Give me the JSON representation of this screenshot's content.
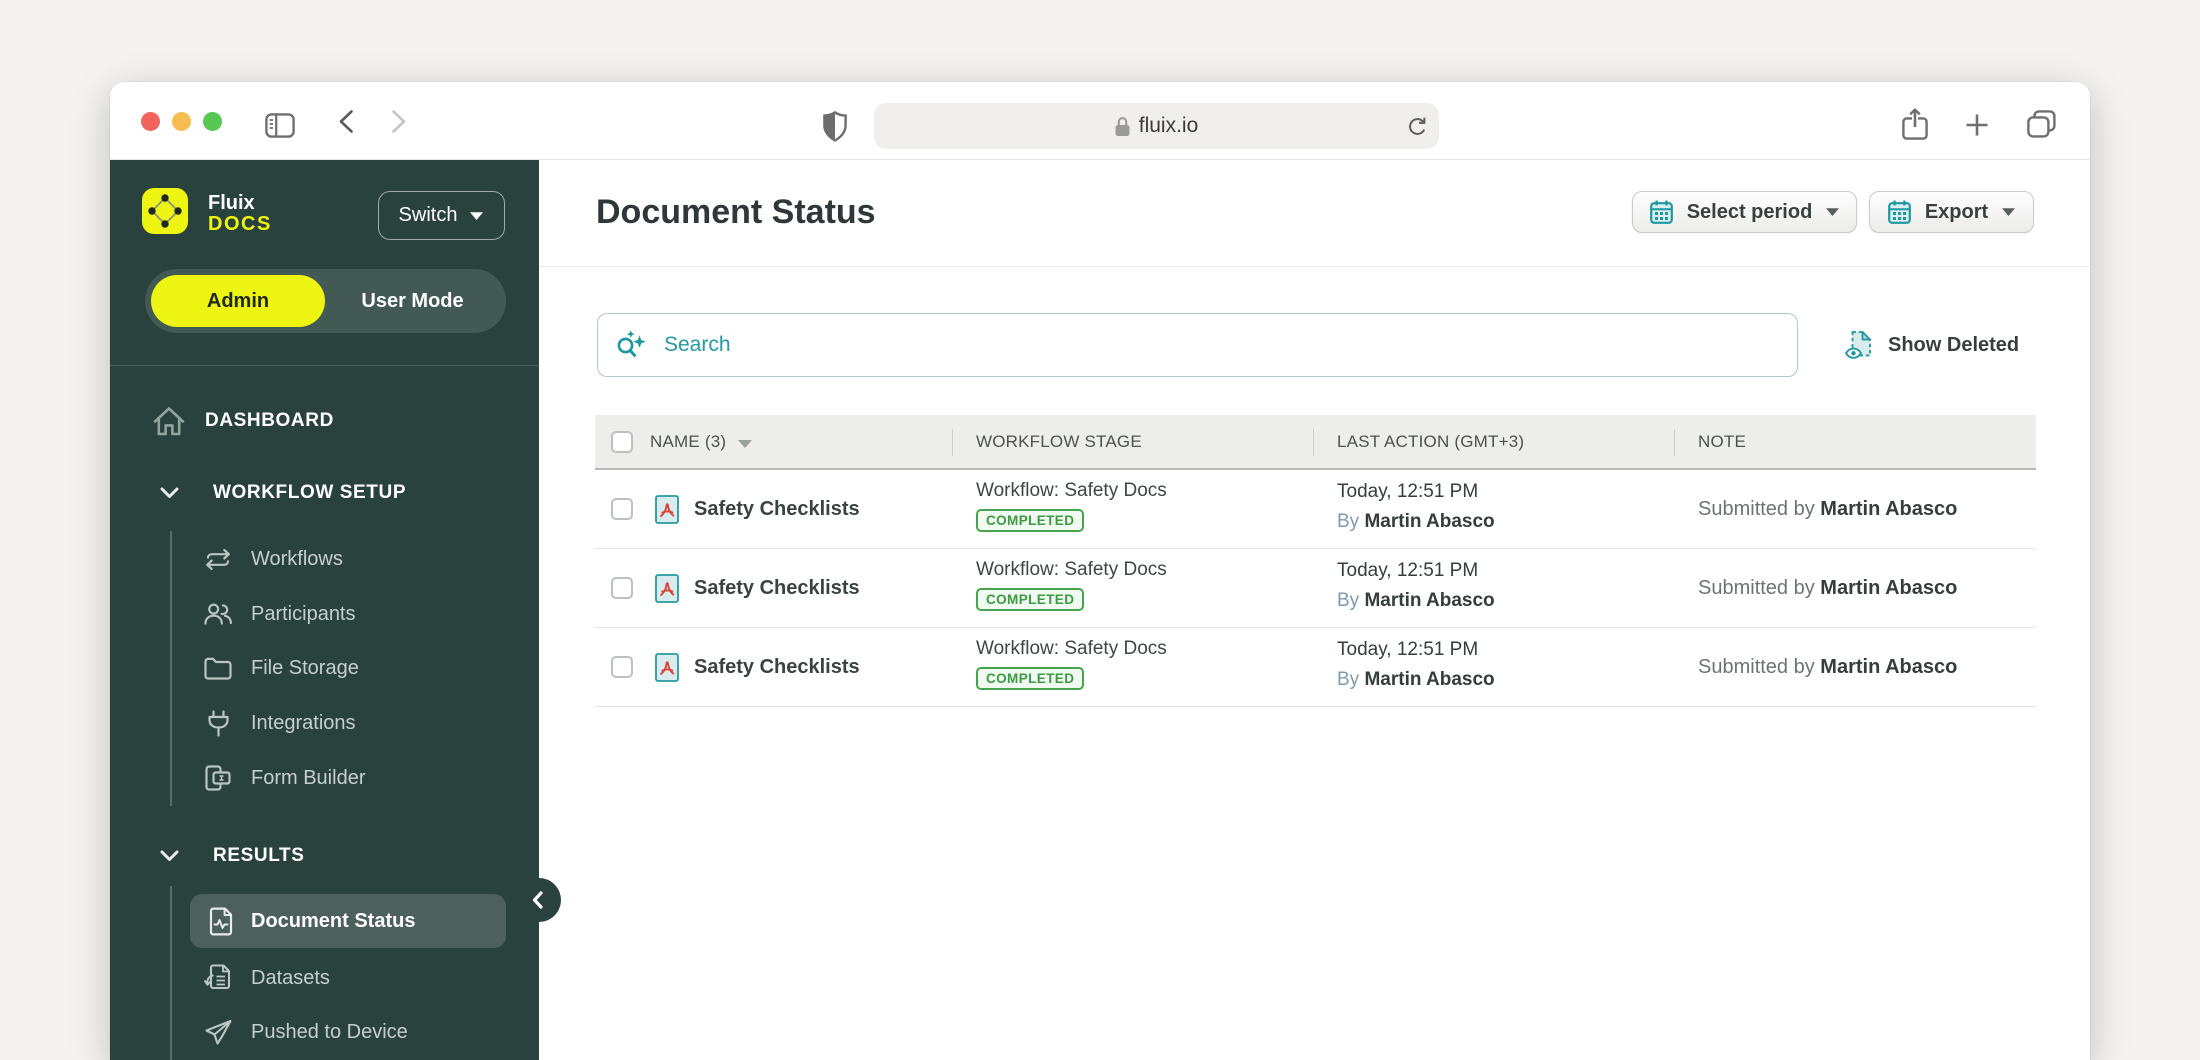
{
  "browser": {
    "url": "fluix.io"
  },
  "sidebar": {
    "brand_line1": "Fluix",
    "brand_line2": "DOCS",
    "switch_label": "Switch",
    "mode_admin": "Admin",
    "mode_user": "User Mode",
    "dashboard_label": "DASHBOARD",
    "workflow_section_label": "WORKFLOW SETUP",
    "workflow_items": [
      "Workflows",
      "Participants",
      "File Storage",
      "Integrations",
      "Form Builder"
    ],
    "results_section_label": "RESULTS",
    "results_items": [
      "Document Status",
      "Datasets",
      "Pushed to Device"
    ],
    "selected_item": "Document Status"
  },
  "main": {
    "title": "Document Status",
    "select_period_label": "Select period",
    "export_label": "Export",
    "search_placeholder": "Search",
    "show_deleted_label": "Show Deleted",
    "table": {
      "columns": [
        "NAME (3)",
        "WORKFLOW STAGE",
        "LAST ACTION (GMT+3)",
        "NOTE"
      ],
      "rows": [
        {
          "name": "Safety Checklists",
          "stage": "Workflow: Safety Docs",
          "badge": "COMPLETED",
          "time": "Today, 12:51 PM",
          "by_prefix": "By ",
          "by_name": "Martin Abasco",
          "note_prefix": "Submitted by ",
          "note_name": "Martin Abasco"
        },
        {
          "name": "Safety Checklists",
          "stage": "Workflow: Safety Docs",
          "badge": "COMPLETED",
          "time": "Today, 12:51 PM",
          "by_prefix": "By ",
          "by_name": "Martin Abasco",
          "note_prefix": "Submitted by ",
          "note_name": "Martin Abasco"
        },
        {
          "name": "Safety Checklists",
          "stage": "Workflow: Safety Docs",
          "badge": "COMPLETED",
          "time": "Today, 12:51 PM",
          "by_prefix": "By ",
          "by_name": "Martin Abasco",
          "note_prefix": "Submitted by ",
          "note_name": "Martin Abasco"
        }
      ]
    }
  },
  "colors": {
    "sidebar": "#2a423d",
    "accent_yellow": "#eff512",
    "accent_teal": "#1d98a1",
    "badge_green": "#46a44c",
    "page_background": "#f4f3f1"
  }
}
